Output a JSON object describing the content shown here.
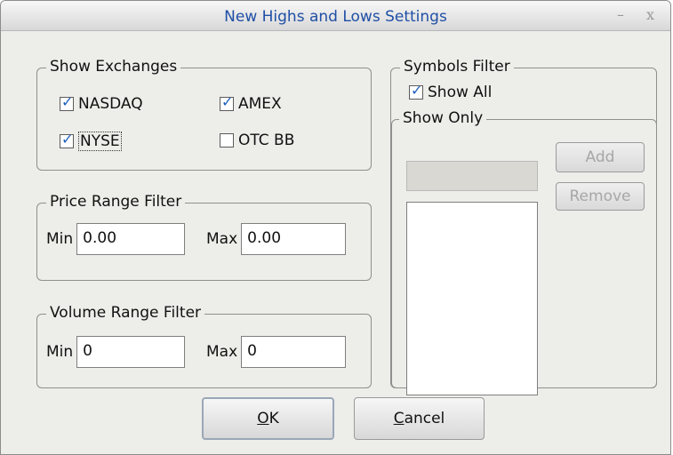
{
  "window": {
    "title": "New Highs and Lows Settings",
    "minimize": "–",
    "close": "x"
  },
  "show_exchanges": {
    "legend": "Show Exchanges",
    "items": [
      {
        "label": "NASDAQ",
        "checked": true
      },
      {
        "label": "AMEX",
        "checked": true
      },
      {
        "label": "NYSE",
        "checked": true
      },
      {
        "label": "OTC BB",
        "checked": false
      }
    ]
  },
  "price_range": {
    "legend": "Price Range Filter",
    "min_label": "Min",
    "min_value": "0.00",
    "max_label": "Max",
    "max_value": "0.00"
  },
  "volume_range": {
    "legend": "Volume Range Filter",
    "min_label": "Min",
    "min_value": "0",
    "max_label": "Max",
    "max_value": "0"
  },
  "symbols_filter": {
    "legend": "Symbols Filter",
    "show_all_label": "Show All",
    "show_all_checked": true,
    "show_only": {
      "legend": "Show Only",
      "add_label": "Add",
      "remove_label": "Remove"
    }
  },
  "buttons": {
    "ok_access": "O",
    "ok_rest": "K",
    "cancel_access": "C",
    "cancel_rest": "ancel"
  }
}
